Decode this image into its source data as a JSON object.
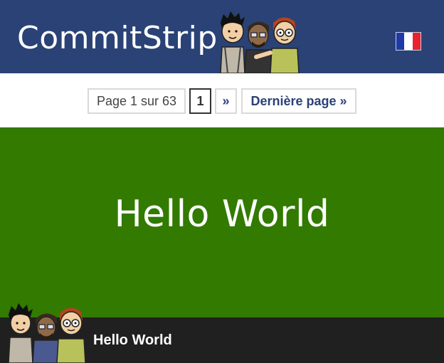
{
  "header": {
    "logo_text": "CommitStrip",
    "background_color": "#2a4276",
    "language_flag_icon": "flag-france-icon",
    "flag_colors": [
      "#1f3aa8",
      "#ffffff",
      "#e8222f"
    ]
  },
  "pagination": {
    "page_info": "Page 1 sur 63",
    "current_page": "1",
    "next_label": "»",
    "last_label": "Dernière page »"
  },
  "strip": {
    "background_color": "#327a00",
    "title": "Hello World"
  },
  "footer": {
    "title": "Hello World",
    "background_color": "#202020"
  }
}
